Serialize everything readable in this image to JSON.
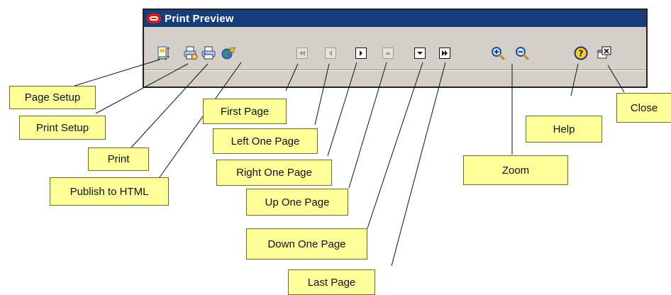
{
  "window": {
    "title": "Print Preview"
  },
  "toolbar": {
    "buttons": [
      {
        "id": "page-setup",
        "icon": "page-setup-icon"
      },
      {
        "id": "print-setup",
        "icon": "print-setup-icon"
      },
      {
        "id": "print",
        "icon": "printer-icon"
      },
      {
        "id": "publish-html",
        "icon": "globe-icon"
      },
      {
        "id": "first-page",
        "icon": "first-page-icon"
      },
      {
        "id": "left-one-page",
        "icon": "left-page-icon"
      },
      {
        "id": "right-one-page",
        "icon": "right-page-icon"
      },
      {
        "id": "up-one-page",
        "icon": "up-page-icon"
      },
      {
        "id": "down-one-page",
        "icon": "down-page-icon"
      },
      {
        "id": "last-page",
        "icon": "last-page-icon"
      },
      {
        "id": "zoom-in",
        "icon": "zoom-in-icon"
      },
      {
        "id": "zoom-out",
        "icon": "zoom-out-icon"
      },
      {
        "id": "help",
        "icon": "help-icon"
      },
      {
        "id": "close",
        "icon": "close-window-icon"
      }
    ]
  },
  "callouts": {
    "page_setup": "Page Setup",
    "print_setup": "Print Setup",
    "print": "Print",
    "publish_html": "Publish to HTML",
    "first_page": "First Page",
    "left_one_page": "Left One Page",
    "right_one_page": "Right One Page",
    "up_one_page": "Up One Page",
    "down_one_page": "Down One Page",
    "last_page": "Last Page",
    "zoom": "Zoom",
    "help": "Help",
    "close": "Close"
  },
  "colors": {
    "titlebar": "#173d7a",
    "toolbar": "#d4d0c8",
    "callout": "#ffff99",
    "logo": "#d51d1d"
  }
}
